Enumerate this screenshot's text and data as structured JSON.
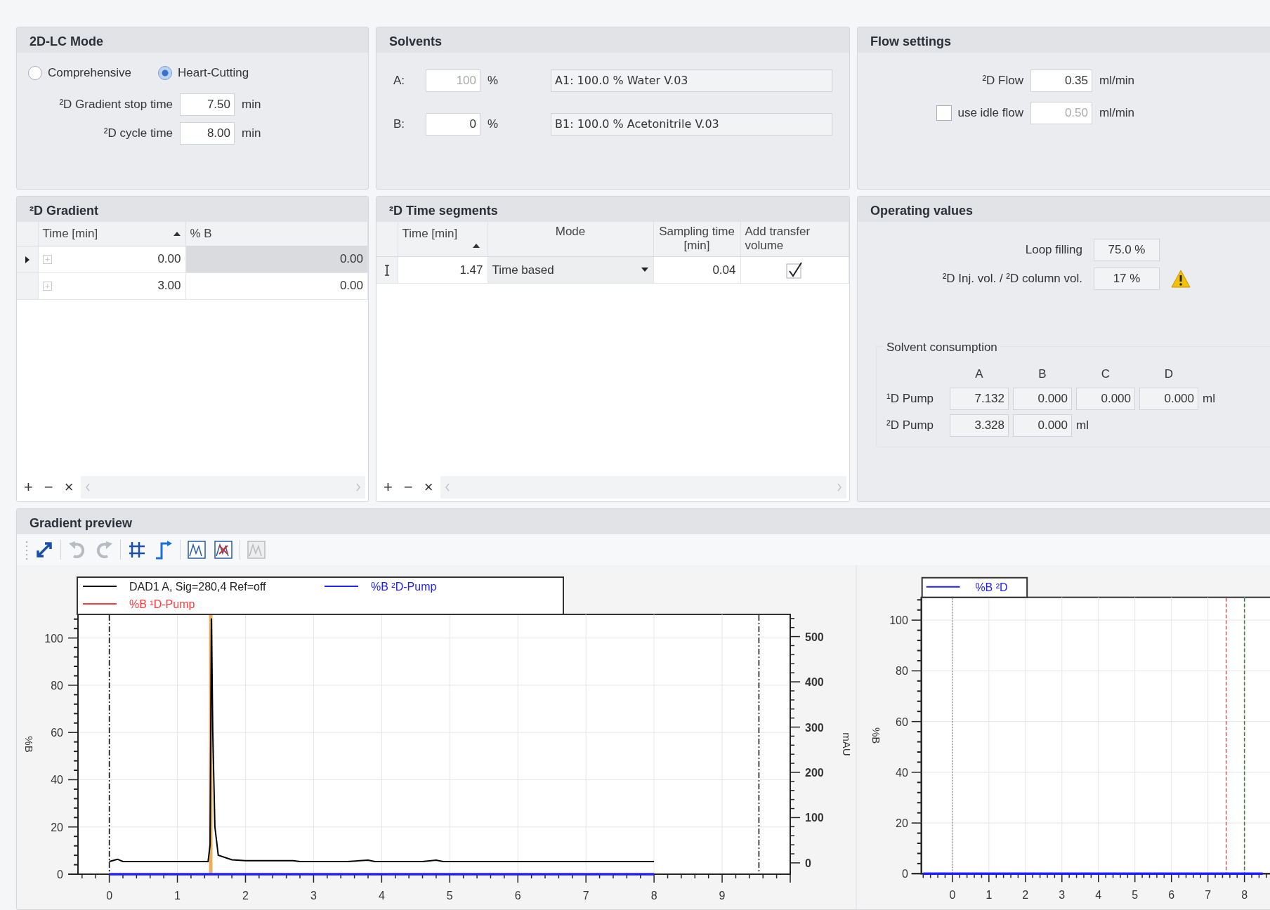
{
  "mode_panel": {
    "title": "2D-LC Mode",
    "options": [
      {
        "label": "Comprehensive",
        "selected": false
      },
      {
        "label": "Heart-Cutting",
        "selected": true
      }
    ],
    "fields": [
      {
        "label": "²D Gradient stop time",
        "value": "7.50",
        "unit": "min"
      },
      {
        "label": "²D cycle time",
        "value": "8.00",
        "unit": "min"
      }
    ]
  },
  "solvents": {
    "title": "Solvents",
    "rows": [
      {
        "label": "A:",
        "percent": "100",
        "unit": "%",
        "disabled": true,
        "name": "A1: 100.0 % Water V.03"
      },
      {
        "label": "B:",
        "percent": "0",
        "unit": "%",
        "disabled": false,
        "name": "B1: 100.0 % Acetonitrile V.03"
      }
    ]
  },
  "flow": {
    "title": "Flow settings",
    "rows": [
      {
        "kind": "field",
        "label": "²D Flow",
        "value": "0.35",
        "unit": "ml/min",
        "disabled": false
      },
      {
        "kind": "checkbox",
        "label": "use idle flow",
        "checked": false,
        "value": "0.50",
        "unit": "ml/min",
        "disabled": true
      }
    ]
  },
  "gradient": {
    "title": "²D Gradient",
    "columns": [
      "Time [min]",
      "% B"
    ],
    "sort_ascending": true,
    "rows": [
      {
        "time": "0.00",
        "percent_b": "0.00",
        "selected": true
      },
      {
        "time": "3.00",
        "percent_b": "0.00",
        "selected": false
      }
    ],
    "footer_buttons": [
      "+",
      "−",
      "×"
    ]
  },
  "time_segments": {
    "title": "²D Time segments",
    "columns": [
      "Time [min]",
      "Mode",
      "Sampling time [min]",
      "Add transfer volume"
    ],
    "sort_ascending": true,
    "rows": [
      {
        "time": "1.47",
        "mode": "Time based",
        "sampling_time": "0.04",
        "add_transfer_volume": true,
        "editing": true
      }
    ],
    "footer_buttons": [
      "+",
      "−",
      "×"
    ]
  },
  "operating": {
    "title": "Operating values",
    "values": [
      {
        "label": "Loop filling",
        "value": "75.0 %",
        "warning": false
      },
      {
        "label": "²D Inj. vol. / ²D column vol.",
        "value": "17 %",
        "warning": true
      }
    ],
    "consumption": {
      "title": "Solvent consumption",
      "columns": [
        "A",
        "B",
        "C",
        "D"
      ],
      "rows": [
        {
          "label": "¹D Pump",
          "values": [
            "7.132",
            "0.000",
            "0.000",
            "0.000"
          ],
          "unit": "ml"
        },
        {
          "label": "²D Pump",
          "values": [
            "3.328",
            "0.000"
          ],
          "unit": "ml"
        }
      ]
    }
  },
  "preview": {
    "title": "Gradient preview",
    "toolbar": [
      {
        "disabled": false
      },
      {
        "disabled": true
      },
      {
        "disabled": true
      },
      {
        "disabled": false
      },
      {
        "disabled": false
      },
      {
        "disabled": false
      },
      {
        "disabled": false
      },
      {
        "disabled": true
      }
    ],
    "charts": [
      {
        "chart_data": {
          "type": "line",
          "ylabel": "%B",
          "y2label": "mAU",
          "xlim": [
            -0.46,
            10
          ],
          "ylim": [
            0,
            110
          ],
          "y2lim": [
            -25,
            549
          ],
          "xticks": [
            0,
            1,
            2,
            3,
            4,
            5,
            6,
            7,
            8,
            9
          ],
          "yticks": [
            0,
            20,
            40,
            60,
            80,
            100
          ],
          "y2ticks": [
            0,
            100,
            200,
            300,
            400,
            500
          ],
          "x": [
            0,
            0.12,
            0.2,
            1.45,
            1.48,
            1.5,
            1.52,
            1.55,
            1.6,
            1.8,
            2,
            2.7,
            2.8,
            3.5,
            3.8,
            3.9,
            4.6,
            4.8,
            4.9,
            8
          ],
          "series": [
            {
              "name": "DAD1 A, Sig=280,4 Ref=off",
              "color": "#000000",
              "axis": "y2",
              "values": [
                3,
                8,
                3,
                3,
                40,
                540,
                290,
                80,
                17,
                7,
                5,
                5,
                3,
                3,
                6,
                3,
                3,
                6,
                3,
                3
              ]
            },
            {
              "name": "%B ²D-Pump",
              "color": "#2020ff",
              "axis": "y",
              "values": [
                0,
                0,
                0,
                0,
                0,
                0,
                0,
                0,
                0,
                0,
                0,
                0,
                0,
                0,
                0,
                0,
                0,
                0,
                0,
                0
              ]
            },
            {
              "name": "%B ¹D-Pump",
              "color": "#ff3b3b",
              "axis": "y",
              "values": [
                null,
                null,
                null,
                null,
                null,
                null,
                null,
                null,
                null,
                null,
                null,
                null,
                null,
                null,
                null,
                null,
                null,
                null,
                null,
                null
              ]
            }
          ],
          "grid": true,
          "legend": "top",
          "ref_lines": [
            {
              "axis": "x",
              "value": 0,
              "color": "#000000"
            },
            {
              "axis": "x",
              "value": 9.54,
              "color": "#000000"
            },
            {
              "axis": "x",
              "value": 1.49,
              "color": "#e8b060"
            }
          ]
        }
      },
      {
        "chart_data": {
          "type": "line",
          "ylabel": "%B",
          "xlim": [
            -0.85,
            8.7
          ],
          "ylim": [
            0,
            109
          ],
          "xticks": [
            0,
            1,
            2,
            3,
            4,
            5,
            6,
            7,
            8
          ],
          "yticks": [
            0,
            20,
            40,
            60,
            80,
            100
          ],
          "x": [
            -0.8,
            8.5
          ],
          "series": [
            {
              "name": "%B ²D",
              "color": "#2020ff",
              "axis": "y",
              "values": [
                0,
                0
              ]
            }
          ],
          "grid": true,
          "legend": "top",
          "ref_lines": [
            {
              "axis": "x",
              "value": 0,
              "color": "#999999"
            },
            {
              "axis": "x",
              "value": 7.5,
              "color": "#ff4040"
            },
            {
              "axis": "x",
              "value": 8,
              "color": "#1a8a1a"
            }
          ]
        }
      }
    ]
  }
}
